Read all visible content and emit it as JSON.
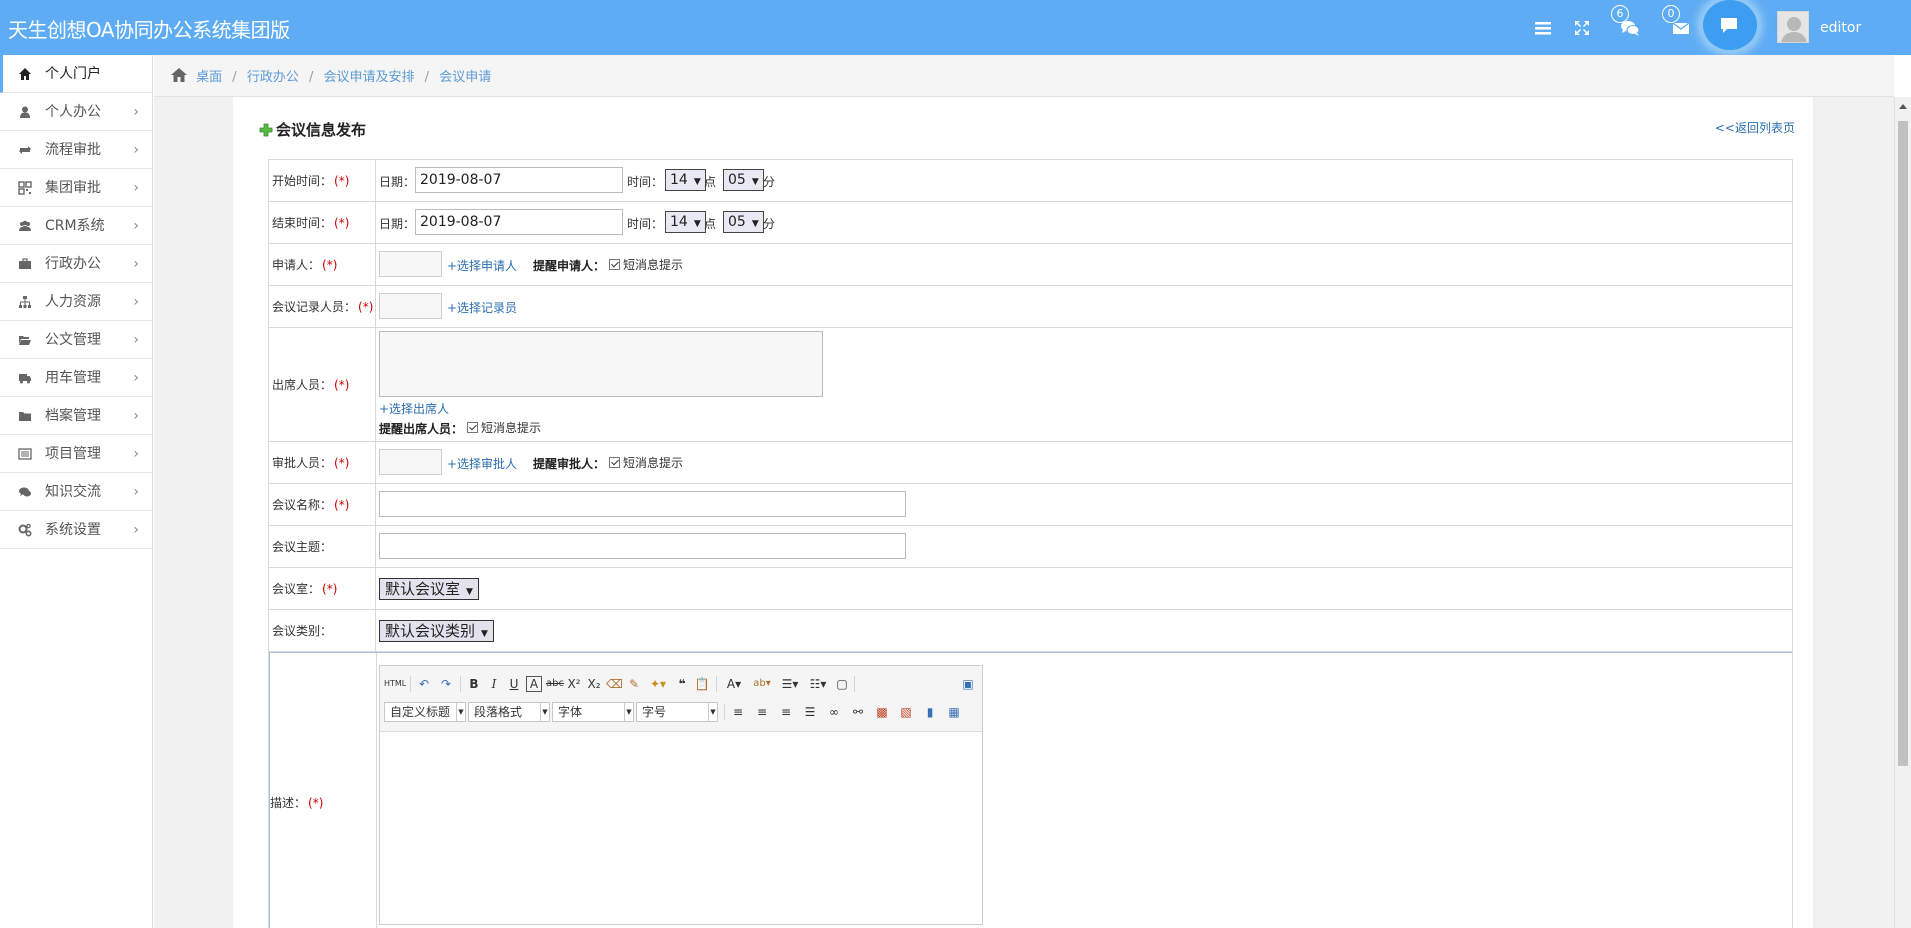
{
  "app": {
    "title": "天生创想OA协同办公系统集团版"
  },
  "header": {
    "messages_count": "6",
    "mail_count": "0",
    "username": "editor"
  },
  "sidebar": {
    "items": [
      {
        "label": "个人门户",
        "icon": "home-icon"
      },
      {
        "label": "个人办公",
        "icon": "user-icon"
      },
      {
        "label": "流程审批",
        "icon": "retweet-icon"
      },
      {
        "label": "集团审批",
        "icon": "qrcode-icon"
      },
      {
        "label": "CRM系统",
        "icon": "users-icon"
      },
      {
        "label": "行政办公",
        "icon": "briefcase-icon"
      },
      {
        "label": "人力资源",
        "icon": "sitemap-icon"
      },
      {
        "label": "公文管理",
        "icon": "folder-open-icon"
      },
      {
        "label": "用车管理",
        "icon": "truck-icon"
      },
      {
        "label": "档案管理",
        "icon": "folder-icon"
      },
      {
        "label": "项目管理",
        "icon": "list-icon"
      },
      {
        "label": "知识交流",
        "icon": "comments-icon"
      },
      {
        "label": "系统设置",
        "icon": "gears-icon"
      }
    ],
    "arrow": "›"
  },
  "breadcrumb": {
    "items": [
      "桌面",
      "行政办公",
      "会议申请及安排",
      "会议申请"
    ],
    "sep": "/"
  },
  "page": {
    "title": "会议信息发布",
    "back_link": "<<返回列表页"
  },
  "form": {
    "required_mark": "(*)",
    "start": {
      "label": "开始时间：",
      "date_label": "日期：",
      "date": "2019-08-07",
      "time_label": "时间：",
      "hour": "14",
      "hour_unit": "点",
      "minute": "05",
      "minute_unit": "分"
    },
    "end": {
      "label": "结束时间：",
      "date_label": "日期：",
      "date": "2019-08-07",
      "time_label": "时间：",
      "hour": "14",
      "hour_unit": "点",
      "minute": "05",
      "minute_unit": "分"
    },
    "applicant": {
      "label": "申请人：",
      "link": "+选择申请人",
      "remind_label": "提醒申请人：",
      "checkbox": "短消息提示"
    },
    "recorder": {
      "label": "会议记录人员：",
      "link": "+选择记录员"
    },
    "attendees": {
      "label": "出席人员：",
      "link": "+选择出席人",
      "remind_label": "提醒出席人员：",
      "checkbox": "短消息提示"
    },
    "approver": {
      "label": "审批人员：",
      "link": "+选择审批人",
      "remind_label": "提醒审批人：",
      "checkbox": "短消息提示"
    },
    "name": {
      "label": "会议名称："
    },
    "topic": {
      "label": "会议主题："
    },
    "room": {
      "label": "会议室：",
      "value": "默认会议室"
    },
    "category": {
      "label": "会议类别：",
      "value": "默认会议类别"
    },
    "description": {
      "label": "描述："
    }
  },
  "editor": {
    "custom_title": "自定义标题",
    "paragraph": "段落格式",
    "font": "字体",
    "size": "字号"
  }
}
